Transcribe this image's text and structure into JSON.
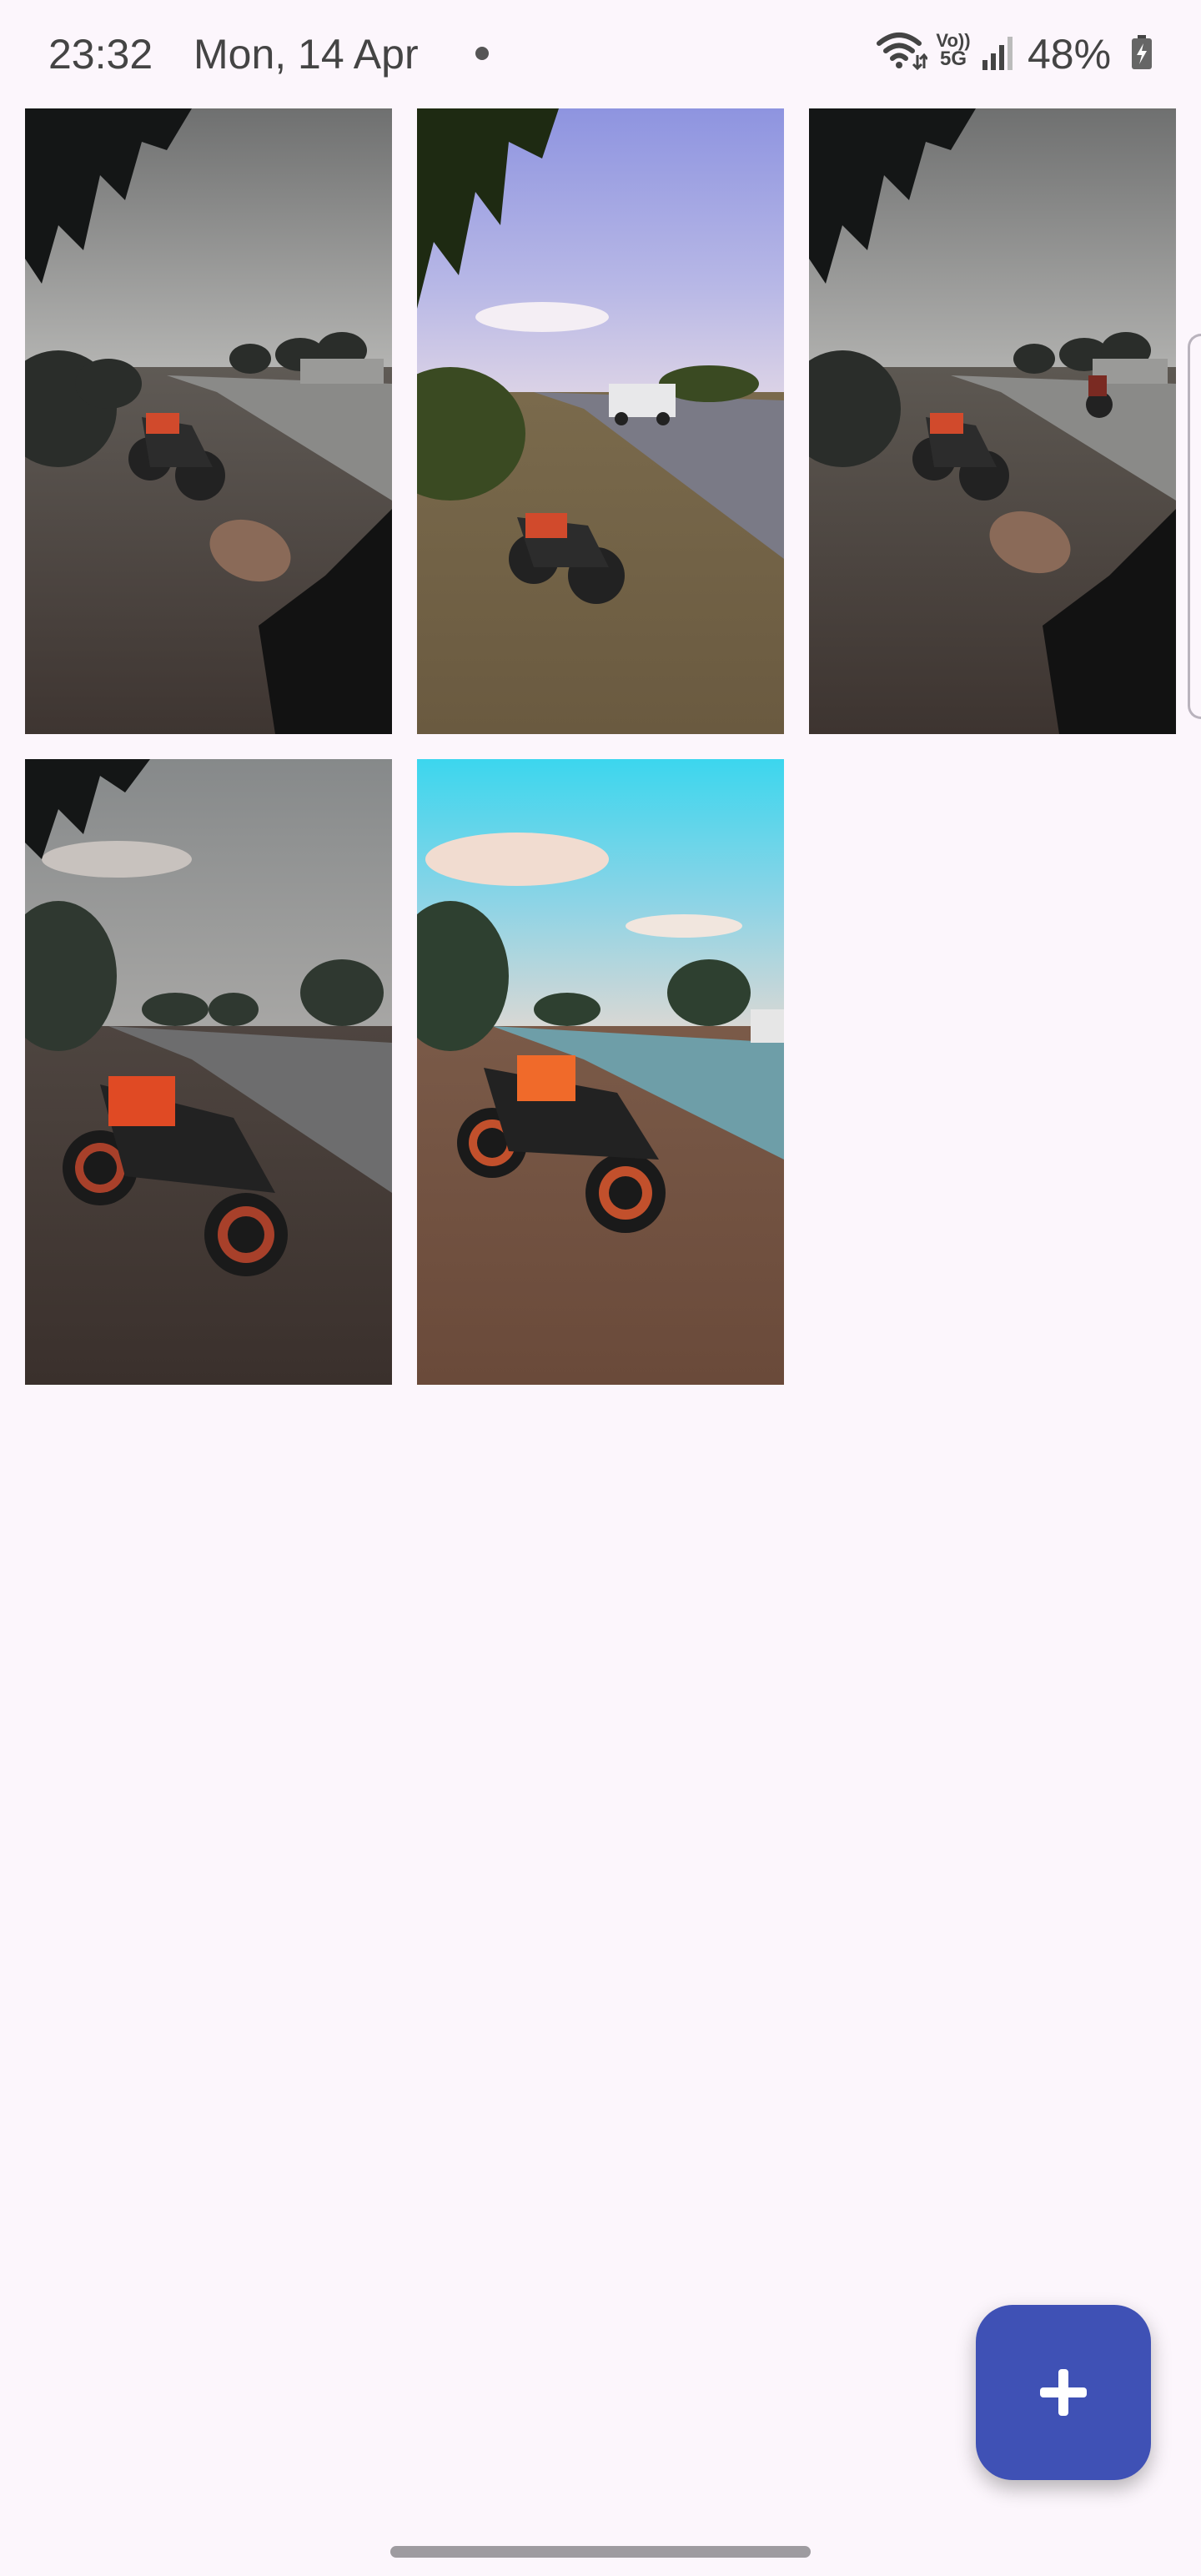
{
  "status_bar": {
    "time": "23:32",
    "date": "Mon, 14 Apr",
    "network_label_top": "Vo))",
    "network_label_bottom": "5G",
    "battery": "48%"
  },
  "icons": {
    "wifi": "wifi-icon",
    "signal": "signal-icon",
    "battery": "battery-charging-icon",
    "fab": "plus-icon"
  },
  "photos": [
    {
      "name": "photo-1",
      "style": "desaturated-with-hand"
    },
    {
      "name": "photo-2",
      "style": "warm-blue-sky-with-truck"
    },
    {
      "name": "photo-3",
      "style": "desaturated-with-hand-and-rider"
    },
    {
      "name": "photo-4",
      "style": "dark-overcast"
    },
    {
      "name": "photo-5",
      "style": "vivid-cyan-sky"
    }
  ],
  "colors": {
    "background": "#fcf6fc",
    "fab": "#3f51b5"
  }
}
